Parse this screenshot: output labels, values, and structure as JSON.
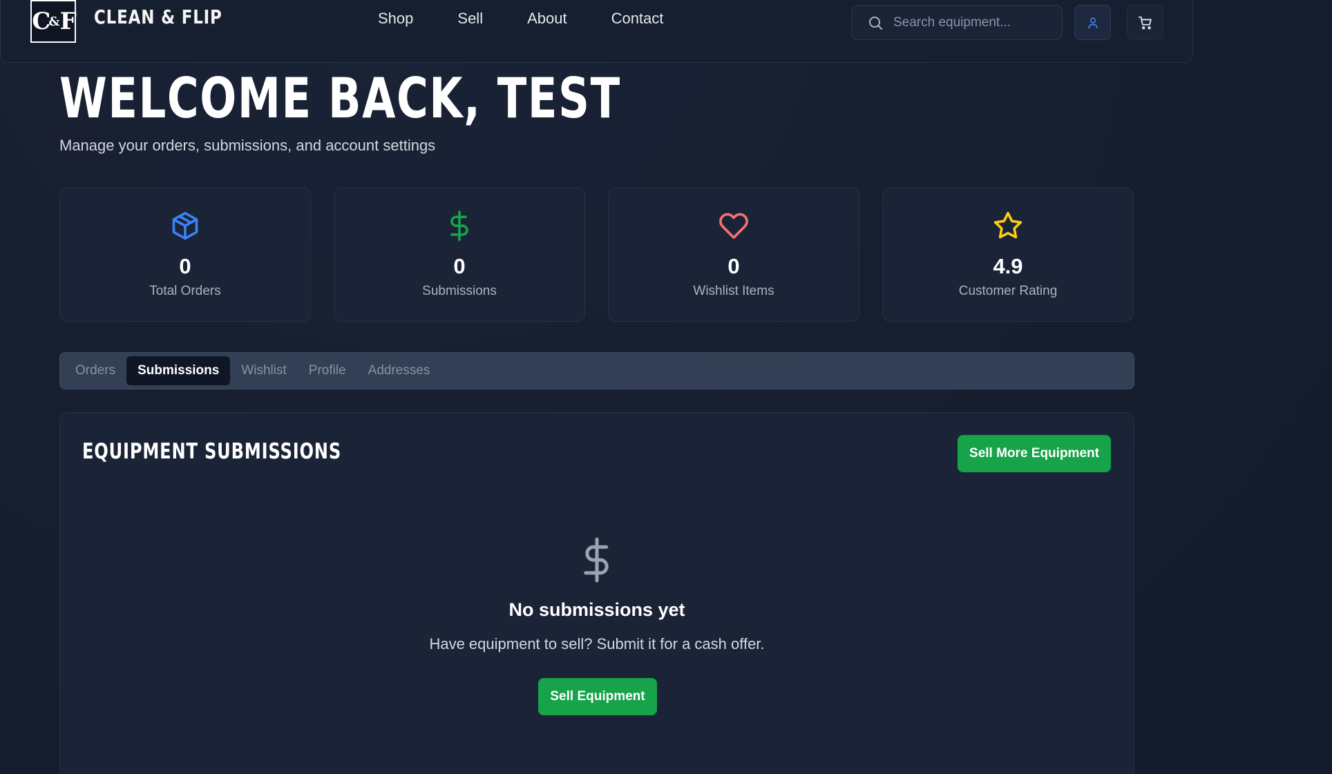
{
  "header": {
    "logo_text": "C&F",
    "brand": "CLEAN & FLIP",
    "nav": [
      "Shop",
      "Sell",
      "About",
      "Contact"
    ],
    "search_placeholder": "Search equipment...",
    "icons": {
      "search": "search-icon",
      "user": "user-icon",
      "cart": "cart-icon"
    },
    "accent_color": "#3b82f6"
  },
  "welcome": {
    "title": "WELCOME BACK, TEST",
    "subtitle": "Manage your orders, submissions, and account settings"
  },
  "stats": [
    {
      "icon": "package-icon",
      "value": "0",
      "label": "Total Orders",
      "color": "#3b82f6"
    },
    {
      "icon": "dollar-icon",
      "value": "0",
      "label": "Submissions",
      "color": "#16a34a"
    },
    {
      "icon": "heart-icon",
      "value": "0",
      "label": "Wishlist Items",
      "color": "#f87171"
    },
    {
      "icon": "star-icon",
      "value": "4.9",
      "label": "Customer Rating",
      "color": "#facc15"
    }
  ],
  "tabs": {
    "items": [
      "Orders",
      "Submissions",
      "Wishlist",
      "Profile",
      "Addresses"
    ],
    "active": "Submissions"
  },
  "submissions": {
    "title": "EQUIPMENT SUBMISSIONS",
    "sell_more_label": "Sell More Equipment",
    "empty_icon": "dollar-icon",
    "empty_title": "No submissions yet",
    "empty_text": "Have equipment to sell? Submit it for a cash offer.",
    "sell_button_label": "Sell Equipment",
    "button_color": "#16a34a"
  }
}
